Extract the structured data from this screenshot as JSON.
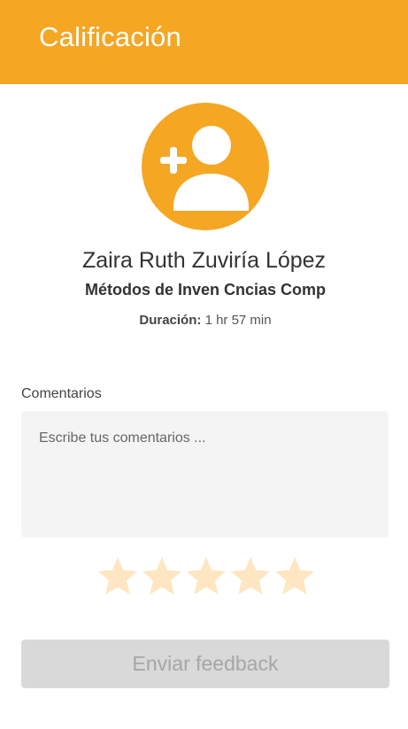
{
  "header": {
    "title": "Calificación"
  },
  "profile": {
    "avatar_icon": "add-user-icon",
    "name": "Zaira Ruth Zuviría López",
    "course": "Métodos de Inven Cncias Comp",
    "duration_label": "Duración:",
    "duration_value": "1 hr 57 min"
  },
  "comments": {
    "label": "Comentarios",
    "value": "",
    "placeholder": "Escribe tus comentarios ..."
  },
  "rating": {
    "max": 5,
    "value": 0,
    "star_icon": "star-icon",
    "empty_color": "#FDE6C1"
  },
  "submit": {
    "label": "Enviar feedback"
  },
  "colors": {
    "accent": "#F5A623",
    "button_disabled_bg": "#D9D9D9",
    "button_disabled_text": "#A6A6A6"
  }
}
